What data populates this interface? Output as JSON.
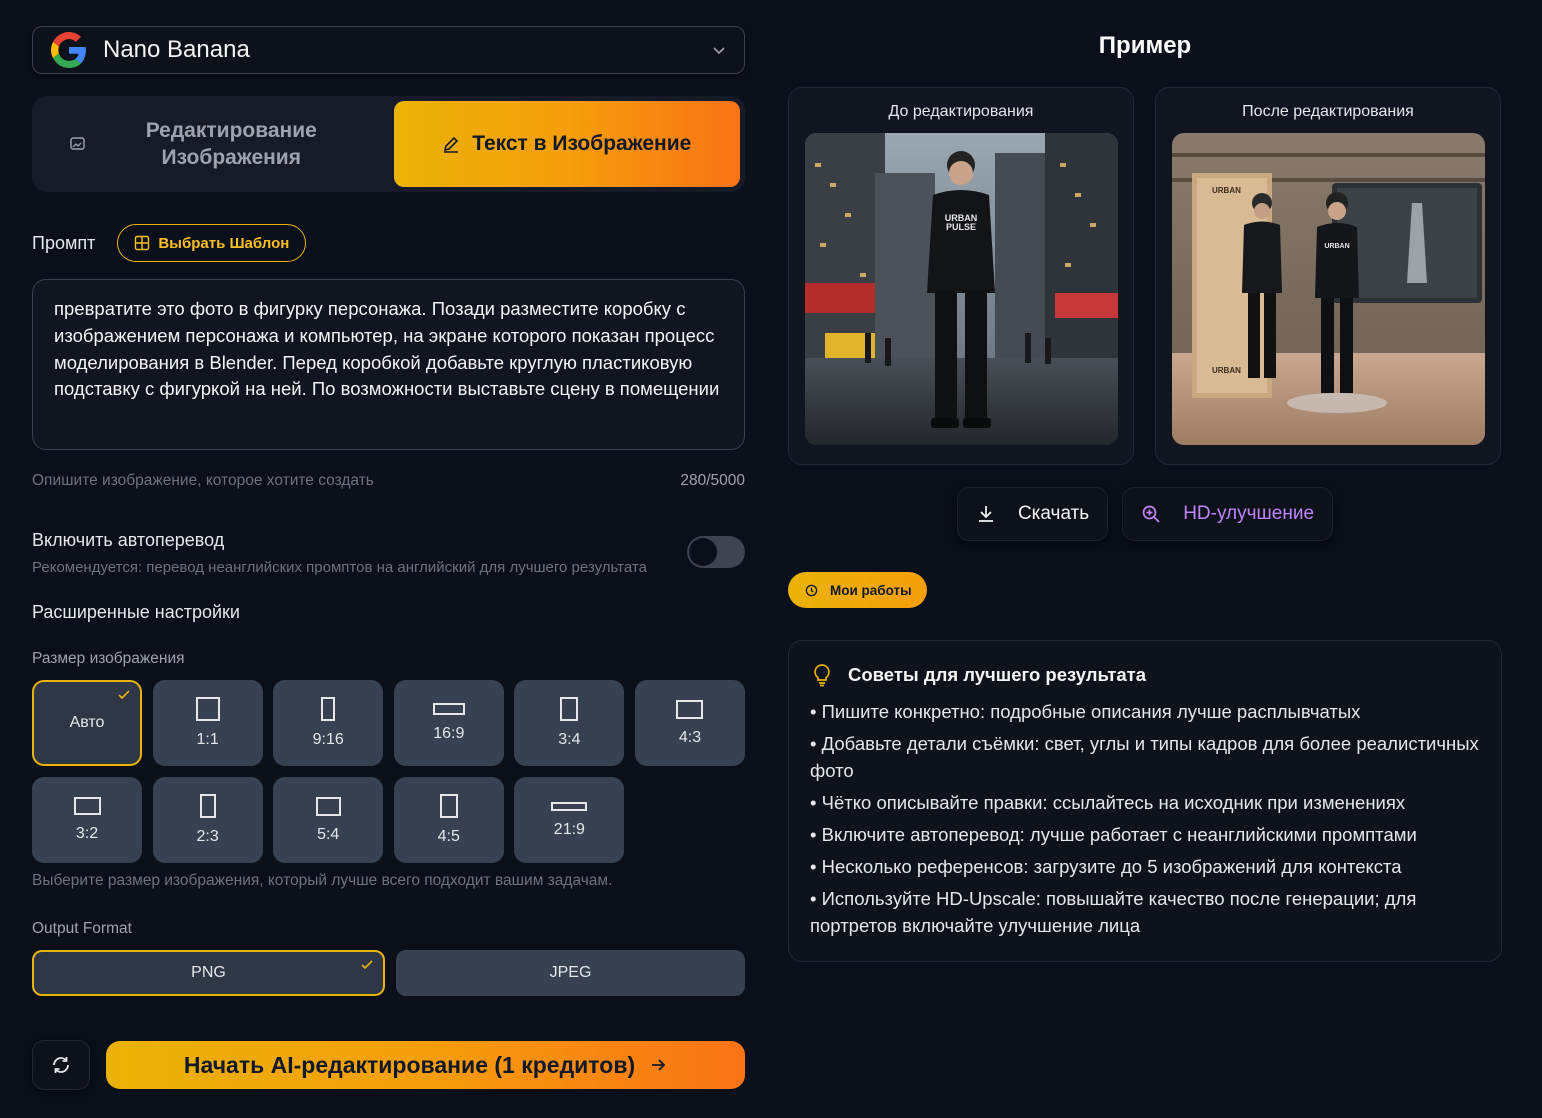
{
  "model": {
    "name": "Nano Banana"
  },
  "mode_tabs": {
    "edit_label": "Редактирование Изображения",
    "text_to_image_label": "Текст в Изображение"
  },
  "prompt": {
    "label": "Промпт",
    "template_button": "Выбрать Шаблон",
    "text": "превратите это фото в фигурку персонажа. Позади разместите коробку с изображением персонажа и компьютер, на экране которого показан процесс моделирования в Blender. Перед коробкой добавьте круглую пластиковую подставку с фигуркой на ней. По возможности выставьте сцену в помещении",
    "hint": "Опишите изображение, которое хотите создать",
    "counter": "280/5000"
  },
  "auto_translate": {
    "title": "Включить автоперевод",
    "description": "Рекомендуется: перевод неанглийских промптов на английский для лучшего результата",
    "enabled": false
  },
  "advanced": {
    "title": "Расширенные настройки",
    "size_label": "Размер изображения",
    "sizes": [
      "Авто",
      "1:1",
      "9:16",
      "16:9",
      "3:4",
      "4:3",
      "3:2",
      "2:3",
      "5:4",
      "4:5",
      "21:9"
    ],
    "selected_size": "Авто",
    "size_hint": "Выберите размер изображения, который лучше всего подходит вашим задачам.",
    "format_label": "Output Format",
    "formats": [
      "PNG",
      "JPEG"
    ],
    "selected_format": "PNG"
  },
  "start_button": "Начать AI-редактирование (1 кредитов)",
  "example": {
    "title": "Пример",
    "before_label": "До редактирования",
    "after_label": "После редактирования"
  },
  "actions": {
    "download": "Скачать",
    "hd": "HD-улучшение",
    "my_works": "Мои работы"
  },
  "tips": {
    "title": "Советы для лучшего результата",
    "items": [
      "Пишите конкретно: подробные описания лучше расплывчатых",
      "Добавьте детали съёмки: свет, углы и типы кадров для более реалистичных фото",
      "Чётко описывайте правки: ссылайтесь на исходник при изменениях",
      "Включите автоперевод: лучше работает с неанглийскими промптами",
      "Несколько референсов: загрузите до 5 изображений для контекста",
      "Используйте HD-Upscale: повышайте качество после генерации; для портретов включайте улучшение лица"
    ]
  },
  "colors": {
    "accent_start": "#eab308",
    "accent_end": "#f97316",
    "background": "#0b0f19",
    "hd_purple": "#c084fc"
  },
  "icons": [
    "google-logo-icon",
    "chevron-down-icon",
    "image-edit-icon",
    "pencil-icon",
    "template-grid-icon",
    "check-icon",
    "refresh-icon",
    "arrow-right-icon",
    "download-icon",
    "zoom-in-icon",
    "clock-icon",
    "lightbulb-icon"
  ]
}
